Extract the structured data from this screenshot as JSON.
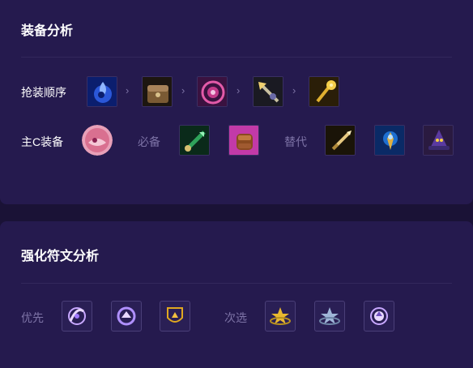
{
  "equipment_section": {
    "title": "装备分析",
    "order_label": "抢装顺序",
    "order_items": [
      {
        "icon": "blue-tear-icon",
        "color": "#2b57d8"
      },
      {
        "icon": "treasure-chest-icon",
        "color": "#7a5a34"
      },
      {
        "icon": "shield-spiral-icon",
        "color": "#c33a8a"
      },
      {
        "icon": "spear-icon",
        "color": "#9a8a55"
      },
      {
        "icon": "golden-staff-icon",
        "color": "#d9a51f"
      }
    ],
    "arrow_glyph": "›",
    "main_c_label": "主C装备",
    "required_label": "必备",
    "required_items": [
      {
        "icon": "green-blade-icon",
        "color": "#2fa35a"
      },
      {
        "icon": "flaming-fist-icon",
        "color": "#b2339a"
      }
    ],
    "alternative_label": "替代",
    "alternative_items": [
      {
        "icon": "dagger-icon",
        "color": "#b08a3a"
      },
      {
        "icon": "blue-gold-staff-icon",
        "color": "#1e6fd0"
      },
      {
        "icon": "witch-hat-icon",
        "color": "#5a3aa0"
      }
    ]
  },
  "augment_section": {
    "title": "强化符文分析",
    "priority_label": "优先",
    "priority_items": [
      {
        "icon": "vortex-augment-icon"
      },
      {
        "icon": "spin-augment-icon"
      },
      {
        "icon": "crest-augment-icon"
      }
    ],
    "secondary_label": "次选",
    "secondary_items": [
      {
        "icon": "star-ring-augment-icon"
      },
      {
        "icon": "star-silver-augment-icon"
      },
      {
        "icon": "orb-augment-icon"
      }
    ]
  }
}
